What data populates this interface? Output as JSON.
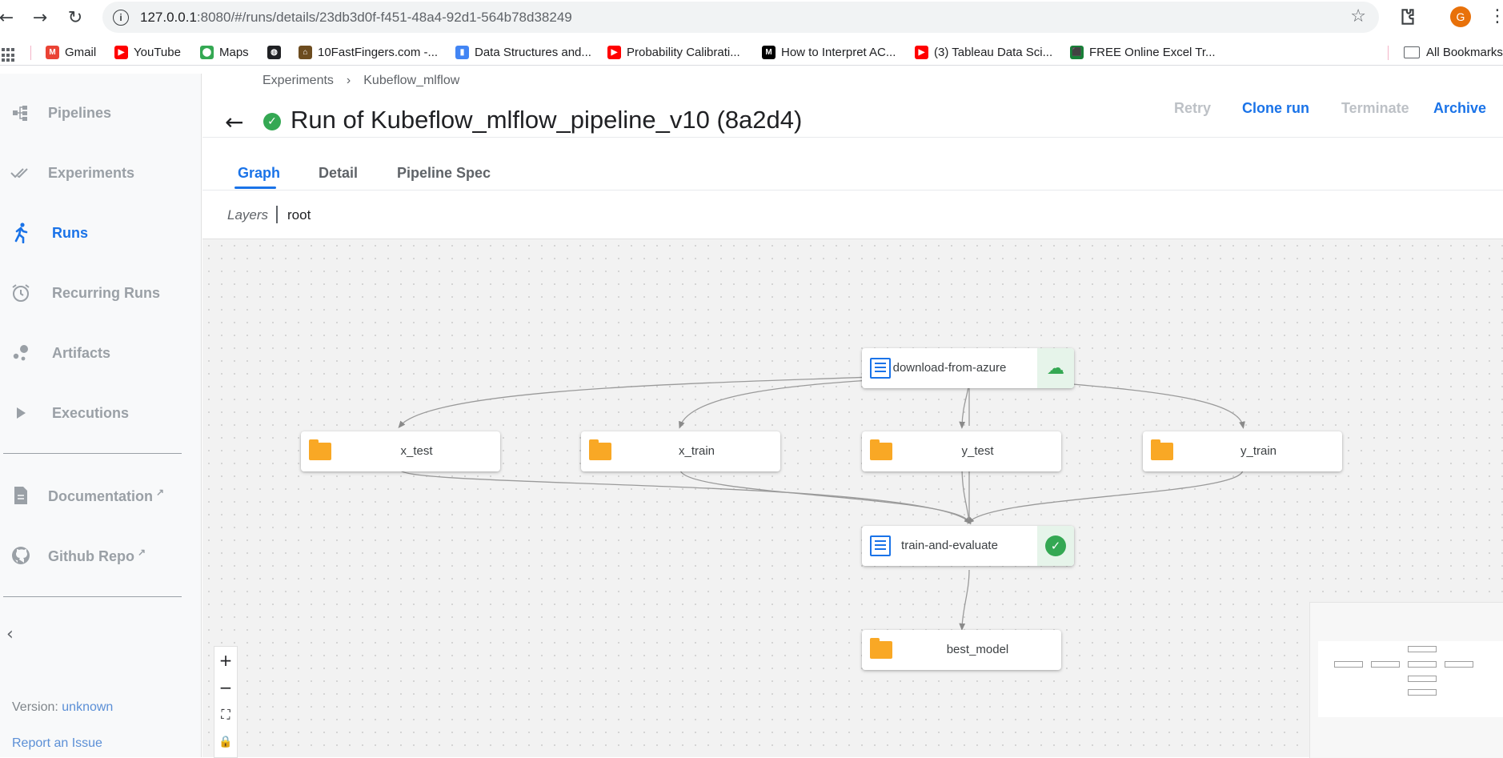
{
  "browser": {
    "url_host": "127.0.0.1",
    "url_path": ":8080/#/runs/details/23db3d0f-f451-48a4-92d1-564b78d38249",
    "profile_initial": "G"
  },
  "bookmarks": [
    {
      "label": "Gmail",
      "color": "#ea4335"
    },
    {
      "label": "YouTube",
      "color": "#ff0000"
    },
    {
      "label": "Maps",
      "color": "#34a853"
    },
    {
      "label": "",
      "color": "#202124"
    },
    {
      "label": "10FastFingers.com -...",
      "color": "#6d4c1f"
    },
    {
      "label": "Data Structures and...",
      "color": "#4285f4"
    },
    {
      "label": "Probability Calibrati...",
      "color": "#ff0000"
    },
    {
      "label": "How to Interpret AC...",
      "color": "#000000"
    },
    {
      "label": "(3) Tableau Data Sci...",
      "color": "#ff0000"
    },
    {
      "label": "FREE Online Excel Tr...",
      "color": "#188038"
    }
  ],
  "all_bookmarks": "All Bookmarks",
  "sidebar": {
    "items": [
      {
        "label": "Pipelines",
        "icon": "pipelines-icon"
      },
      {
        "label": "Experiments",
        "icon": "experiments-icon"
      },
      {
        "label": "Runs",
        "icon": "runs-icon",
        "active": true
      },
      {
        "label": "Recurring Runs",
        "icon": "alarm-icon"
      },
      {
        "label": "Artifacts",
        "icon": "artifacts-icon"
      },
      {
        "label": "Executions",
        "icon": "play-icon"
      }
    ],
    "links": [
      {
        "label": "Documentation",
        "icon": "document-icon"
      },
      {
        "label": "Github Repo",
        "icon": "github-icon"
      }
    ],
    "version_label": "Version:",
    "version_value": "unknown",
    "report_issue": "Report an Issue"
  },
  "breadcrumb": [
    "Experiments",
    "Kubeflow_mlflow"
  ],
  "page_title": "Run of Kubeflow_mlflow_pipeline_v10 (8a2d4)",
  "actions": [
    {
      "label": "Retry",
      "enabled": false
    },
    {
      "label": "Clone run",
      "enabled": true
    },
    {
      "label": "Terminate",
      "enabled": false
    },
    {
      "label": "Archive",
      "enabled": true
    }
  ],
  "tabs": [
    {
      "label": "Graph",
      "active": true
    },
    {
      "label": "Detail",
      "active": false
    },
    {
      "label": "Pipeline Spec",
      "active": false
    }
  ],
  "layers": {
    "label": "Layers",
    "current": "root"
  },
  "graph": {
    "nodes": [
      {
        "id": "download-from-azure",
        "label": "download-from-azure",
        "kind": "execution",
        "state": "cloud-download"
      },
      {
        "id": "x_test",
        "label": "x_test",
        "kind": "artifact"
      },
      {
        "id": "x_train",
        "label": "x_train",
        "kind": "artifact"
      },
      {
        "id": "y_test",
        "label": "y_test",
        "kind": "artifact"
      },
      {
        "id": "y_train",
        "label": "y_train",
        "kind": "artifact"
      },
      {
        "id": "train-and-evaluate",
        "label": "train-and-evaluate",
        "kind": "execution",
        "state": "succeeded"
      },
      {
        "id": "best_model",
        "label": "best_model",
        "kind": "artifact"
      }
    ],
    "edges": [
      [
        "download-from-azure",
        "x_test"
      ],
      [
        "download-from-azure",
        "x_train"
      ],
      [
        "download-from-azure",
        "y_test"
      ],
      [
        "download-from-azure",
        "y_train"
      ],
      [
        "x_test",
        "train-and-evaluate"
      ],
      [
        "x_train",
        "train-and-evaluate"
      ],
      [
        "y_test",
        "train-and-evaluate"
      ],
      [
        "y_train",
        "train-and-evaluate"
      ],
      [
        "train-and-evaluate",
        "best_model"
      ]
    ]
  },
  "zoom_controls": [
    "+",
    "−",
    "⛶",
    "🔒"
  ]
}
